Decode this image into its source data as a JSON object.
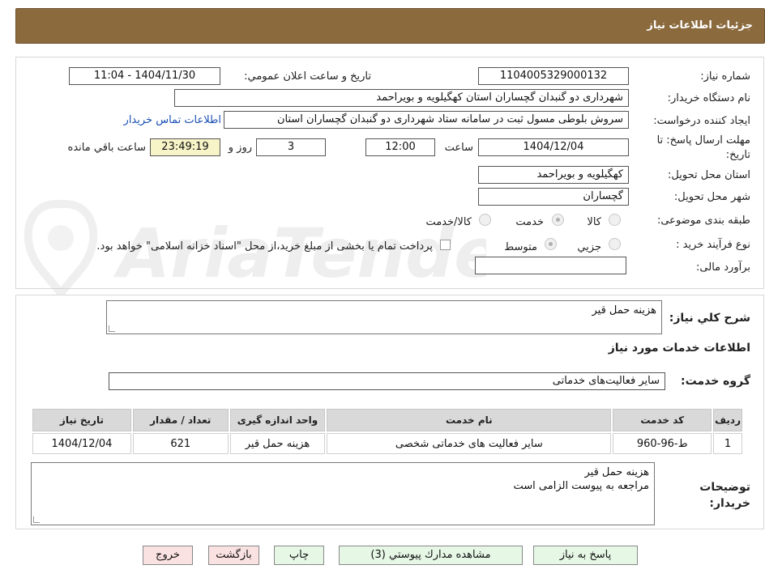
{
  "header": {
    "title": "جزئيات اطلاعات نياز"
  },
  "form": {
    "need_number_label": "شماره نياز:",
    "need_number": "1104005329000132",
    "announce_label": "تاريخ و ساعت اعلان عمومي:",
    "announce_value": "1404/11/30 - 11:04",
    "buyer_org_label": "نام دستگاه خريدار:",
    "buyer_org": "شهرداری دو گنبدان گچساران استان کهگیلویه و بویراحمد",
    "creator_label": "ايجاد كننده درخواست:",
    "creator": "سروش بلوطی مسول ثبت در سامانه ستاد شهرداری دو گنبدان گچساران استان",
    "contact_link": "اطلاعات تماس خريدار",
    "deadline_label": "مهلت ارسال پاسخ: تا تاريخ:",
    "deadline_date": "1404/12/04",
    "time_label": "ساعت",
    "deadline_time": "12:00",
    "days_value": "3",
    "days_label": "روز و",
    "remaining_time": "23:49:19",
    "remaining_label": "ساعت باقي مانده",
    "province_label": "استان محل تحويل:",
    "province": "کهگیلویه و بویراحمد",
    "city_label": "شهر محل تحويل:",
    "city": "گچساران",
    "category_label": "طبقه بندی موضوعی:",
    "category_options": [
      "كالا",
      "خدمت",
      "كالا/خدمت"
    ],
    "category_selected": "خدمت",
    "process_label": "نوع فرآيند خريد :",
    "process_options": [
      "جزيي",
      "متوسط"
    ],
    "process_selected": "متوسط",
    "payment_note": "پرداخت تمام يا بخشی از مبلغ خريد،از محل \"اسناد خزانه اسلامی\" خواهد بود.",
    "budget_label": "برآورد مالی:",
    "budget_value": ""
  },
  "summary": {
    "label": "شرح كلي نياز:",
    "value": "هزینه حمل قیر"
  },
  "services": {
    "section_title": "اطلاعات خدمات مورد نياز",
    "group_label": "گروه خدمت:",
    "group_value": "سایر فعالیت‌های خدماتی",
    "columns": [
      "رديف",
      "كد خدمت",
      "نام خدمت",
      "واحد اندازه گيری",
      "تعداد / مقدار",
      "تاريخ نياز"
    ],
    "rows": [
      [
        "1",
        "ط-96-960",
        "سایر فعالیت های خدماتی شخصی",
        "هزینه حمل قیر",
        "621",
        "1404/12/04"
      ]
    ]
  },
  "buyer_notes": {
    "label": "توضيحات خريدار:",
    "line1": "هزینه حمل قیر",
    "line2": "مراجعه به پیوست الزامی است"
  },
  "buttons": {
    "reply": "پاسخ به نياز",
    "attachments": "مشاهده مدارك پيوستي (3)",
    "print": "چاپ",
    "back": "بازگشت",
    "exit": "خروج"
  },
  "watermark": {
    "text": "AriaTender.neT"
  },
  "colors": {
    "header": "#8b6a3e",
    "link": "#1a4fb3",
    "remaining_bg": "#f7f4c7"
  }
}
